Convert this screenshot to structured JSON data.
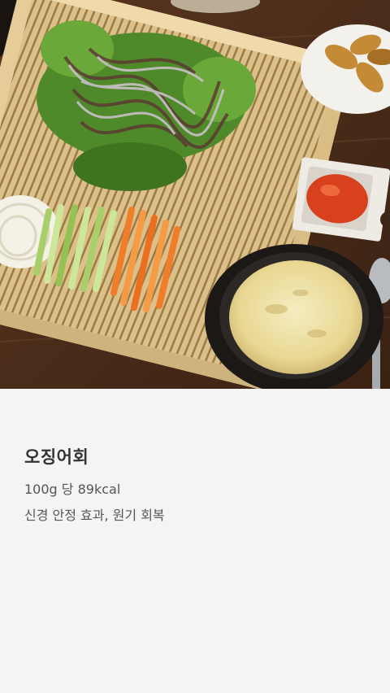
{
  "image": {
    "alt": "오징어회"
  },
  "food": {
    "title": "오징어회",
    "calories": "100g 당 89kcal",
    "benefits": "신경 안정 효과, 원기 회복"
  }
}
